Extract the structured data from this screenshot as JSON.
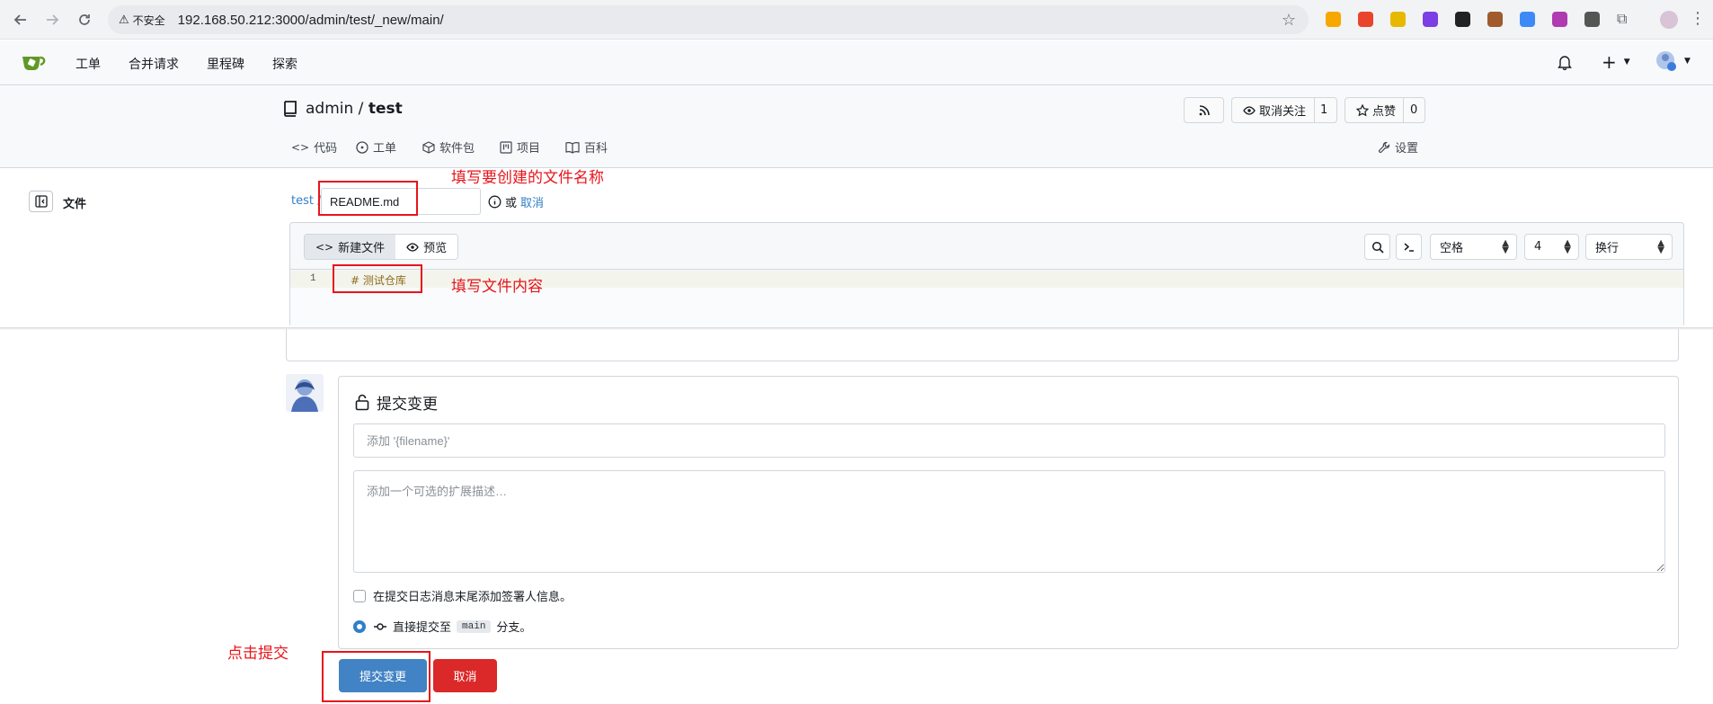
{
  "browser": {
    "security_label": "不安全",
    "url": "192.168.50.212:3000/admin/test/_new/main/",
    "extension_colors": [
      "#f6a800",
      "#e8452c",
      "#e8b800",
      "#7b3fe4",
      "#222222",
      "#a05a2c",
      "#3d8af7",
      "#b03ab0",
      "#555555"
    ]
  },
  "nav": {
    "items": [
      "工单",
      "合并请求",
      "里程碑",
      "探索"
    ],
    "create_symbol": "+"
  },
  "repo": {
    "owner": "admin",
    "separator": " / ",
    "name": "test",
    "unwatch_label": "取消关注",
    "watch_count": "1",
    "star_label": "点赞",
    "star_count": "0",
    "tabs": [
      "代码",
      "工单",
      "软件包",
      "项目",
      "百科"
    ],
    "settings_label": "设置"
  },
  "editor": {
    "files_label": "文件",
    "breadcrumb_repo": "test",
    "breadcrumb_sep": "/",
    "filename_value": "README.md",
    "or_label": "或",
    "cancel_label": "取消",
    "tab_new_file": "新建文件",
    "tab_preview": "预览",
    "indent_style": "空格",
    "indent_size": "4",
    "line_wrap": "换行",
    "line_number": "1",
    "code_line": "# 测试仓库"
  },
  "commit": {
    "title": "提交变更",
    "summary_placeholder": "添加 '{filename}'",
    "description_placeholder": "添加一个可选的扩展描述…",
    "signoff_label": "在提交日志消息末尾添加签署人信息。",
    "direct_commit_prefix": "直接提交至",
    "branch": "main",
    "direct_commit_suffix": "分支。",
    "submit_label": "提交变更",
    "cancel_label": "取消"
  },
  "annotations": {
    "filename_note": "填写要创建的文件名称",
    "content_note": "填写文件内容",
    "submit_note": "点击提交"
  },
  "colors": {
    "accent": "#4183c4",
    "danger": "#db2828",
    "annotation": "#e8141b",
    "link": "#2f7fc8"
  }
}
